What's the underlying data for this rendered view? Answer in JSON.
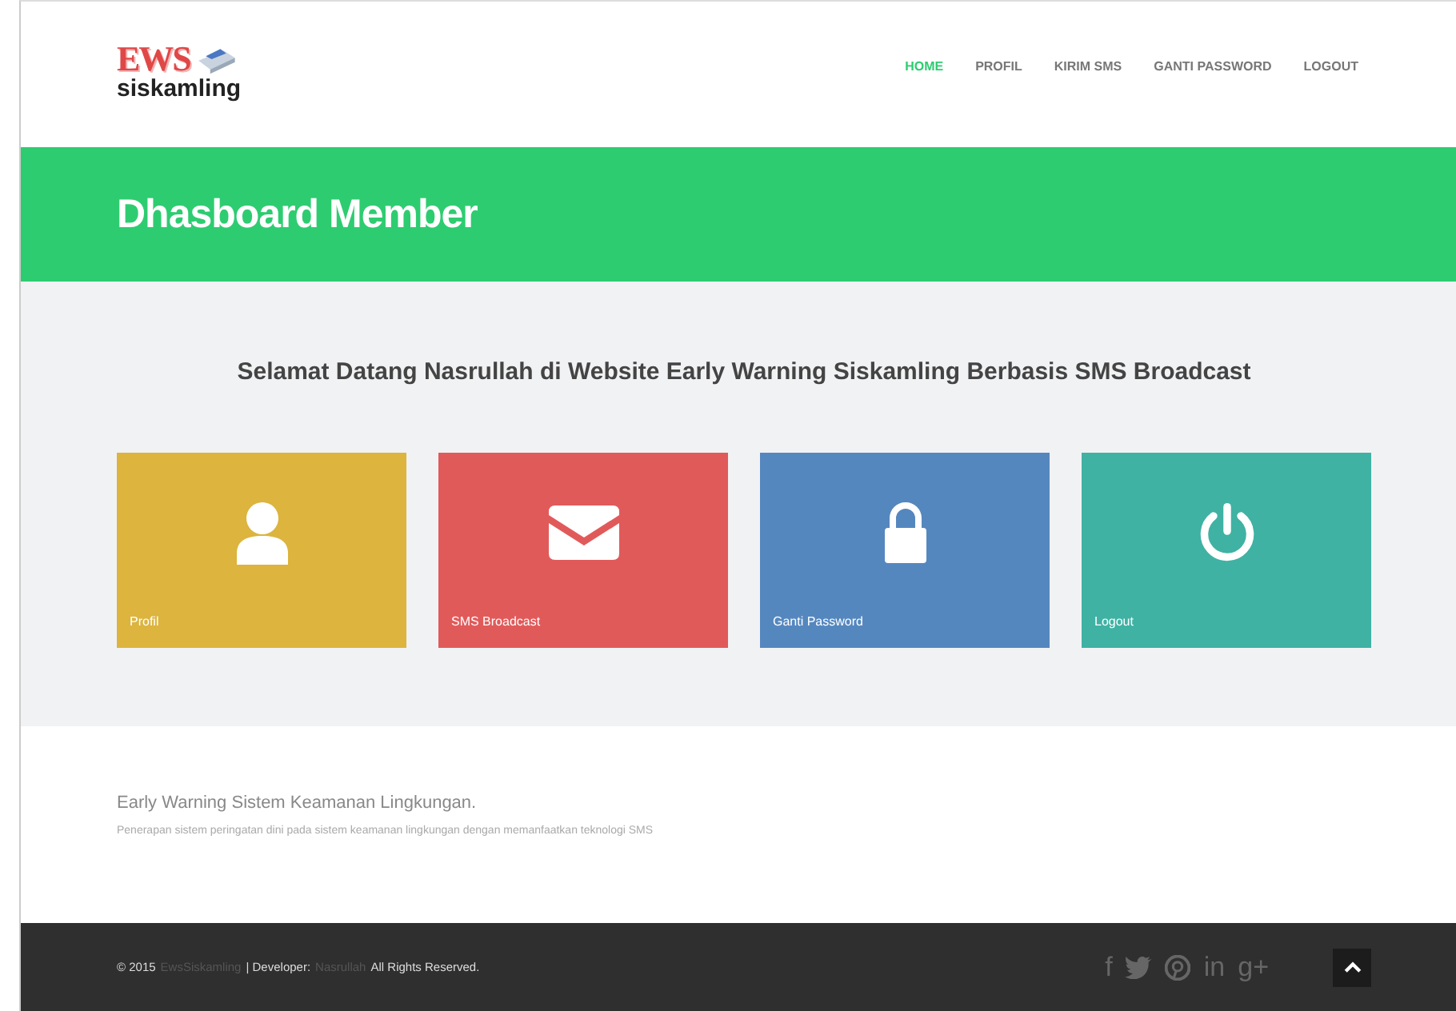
{
  "logo": {
    "mark": "EWS",
    "name": "siskamling"
  },
  "nav": [
    {
      "label": "HOME",
      "selected": true
    },
    {
      "label": "PROFIL",
      "selected": false
    },
    {
      "label": "KIRIM SMS",
      "selected": false
    },
    {
      "label": "GANTI PASSWORD",
      "selected": false
    },
    {
      "label": "LOGOUT",
      "selected": false
    }
  ],
  "banner": {
    "title": "Dhasboard Member"
  },
  "welcome": "Selamat Datang Nasrullah di Website Early Warning Siskamling Berbasis SMS Broadcast",
  "tiles": [
    {
      "label": "Profil",
      "kind": "user",
      "color": "#dcb43e"
    },
    {
      "label": "SMS Broadcast",
      "kind": "mail",
      "color": "#e15a5a"
    },
    {
      "label": "Ganti Password",
      "kind": "lock",
      "color": "#5587bf"
    },
    {
      "label": "Logout",
      "kind": "power",
      "color": "#3fb2a4"
    }
  ],
  "about": {
    "title": "Early Warning Sistem Keamanan Lingkungan.",
    "text": "Penerapan sistem peringatan dini pada sistem keamanan lingkungan dengan memanfaatkan teknologi SMS"
  },
  "footer": {
    "copyright": "© 2015",
    "site_link": "EwsSiskamling",
    "developer": "| Developer:",
    "developer_link": "Nasrullah",
    "rights": "All Rights Reserved.",
    "social": [
      {
        "kind": "glyph",
        "text": "f"
      },
      {
        "kind": "bird"
      },
      {
        "kind": "pin"
      },
      {
        "kind": "glyph",
        "text": "in"
      },
      {
        "kind": "glyph",
        "text": "g+"
      }
    ]
  }
}
